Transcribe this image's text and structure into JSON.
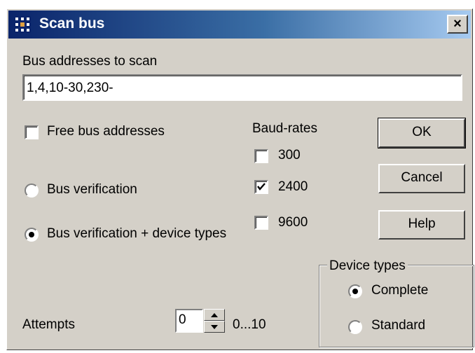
{
  "window": {
    "title": "Scan bus",
    "close_label": "×"
  },
  "addresses": {
    "label": "Bus addresses to scan",
    "value": "1,4,10-30,230-"
  },
  "options": {
    "free_label": "Free bus addresses",
    "free_checked": false,
    "verify_label": "Bus verification",
    "verify_selected": false,
    "verify_types_label": "Bus verification + device types",
    "verify_types_selected": true
  },
  "baud": {
    "label": "Baud-rates",
    "rates": [
      {
        "value": "300",
        "checked": false
      },
      {
        "value": "2400",
        "checked": true
      },
      {
        "value": "9600",
        "checked": false
      }
    ]
  },
  "buttons": {
    "ok": "OK",
    "cancel": "Cancel",
    "help": "Help"
  },
  "device_types": {
    "label": "Device types",
    "complete": "Complete",
    "complete_selected": true,
    "standard": "Standard",
    "standard_selected": false
  },
  "attempts": {
    "label": "Attempts",
    "value": "0",
    "range": "0...10"
  },
  "icons": {
    "app": "grid-app-icon",
    "close": "close-icon",
    "check": "checkmark-icon",
    "spin_up": "spin-up-icon",
    "spin_down": "spin-down-icon"
  }
}
